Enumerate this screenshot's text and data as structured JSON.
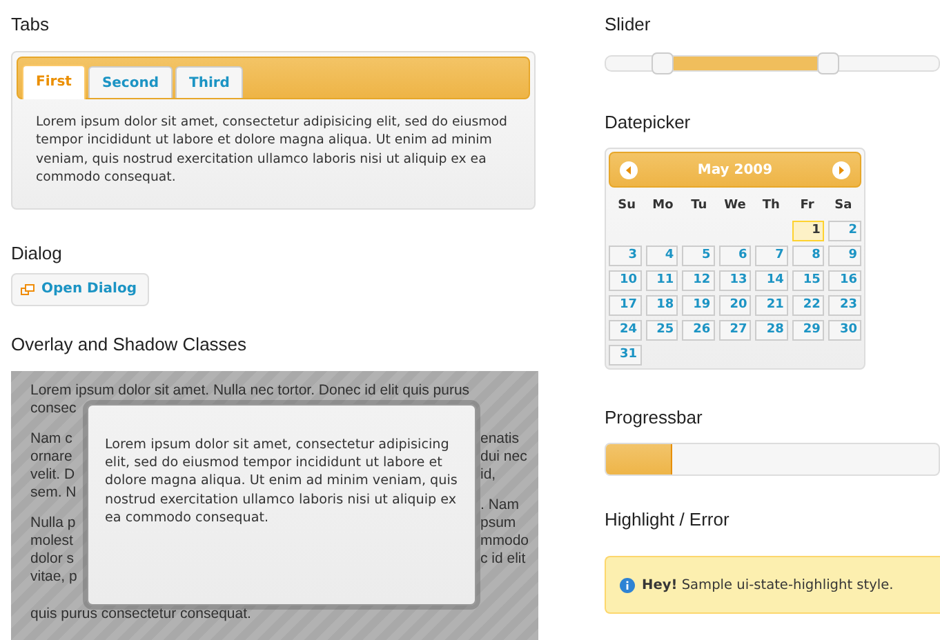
{
  "tabs_section": {
    "heading": "Tabs",
    "tabs": [
      {
        "label": "First",
        "selected": true
      },
      {
        "label": "Second",
        "selected": false
      },
      {
        "label": "Third",
        "selected": false
      }
    ],
    "panel_text": "Lorem ipsum dolor sit amet, consectetur adipisicing elit, sed do eiusmod tempor incididunt ut labore et dolore magna aliqua. Ut enim ad minim veniam, quis nostrud exercitation ullamco laboris nisi ut aliquip ex ea commodo consequat."
  },
  "dialog_section": {
    "heading": "Dialog",
    "button": "Open Dialog"
  },
  "overlay_section": {
    "heading": "Overlay and Shadow Classes",
    "top_line": "Lorem ipsum dolor sit amet. Nulla nec tortor. Donec id elit quis purus",
    "left_fragments": [
      [
        "consec"
      ],
      [
        "Nam c",
        "ornare",
        "velit. D",
        "sem. N"
      ],
      [
        "Nulla p",
        "molest",
        "dolor s",
        "vitae, p"
      ]
    ],
    "right_fragments": [
      [
        "enatis",
        "dui nec",
        "id,"
      ],
      [
        ". Nam",
        "psum",
        "mmodo",
        "c id elit"
      ]
    ],
    "bottom_line": "quis purus consectetur consequat.",
    "dialog_text": "Lorem ipsum dolor sit amet, consectetur adipisicing elit, sed do eiusmod tempor incididunt ut labore et dolore magna aliqua. Ut enim ad minim veniam, quis nostrud exercitation ullamco laboris nisi ut aliquip ex ea commodo consequat."
  },
  "slider_section": {
    "heading": "Slider",
    "handles": [
      {
        "level": 0.17
      },
      {
        "level": 0.67
      }
    ]
  },
  "datepicker_section": {
    "heading": "Datepicker",
    "month": "May 2009",
    "weekdays": [
      "Su",
      "Mo",
      "Tu",
      "We",
      "Th",
      "Fr",
      "Sa"
    ],
    "weeks": [
      [
        {
          "day": "1",
          "highlighted": true
        },
        {
          "day": "2",
          "highlighted": false
        }
      ],
      [
        {
          "day": "3",
          "highlighted": false
        },
        {
          "day": "4",
          "highlighted": false
        },
        {
          "day": "5",
          "highlighted": false
        },
        {
          "day": "6",
          "highlighted": false
        },
        {
          "day": "7",
          "highlighted": false
        },
        {
          "day": "8",
          "highlighted": false
        },
        {
          "day": "9",
          "highlighted": false
        }
      ],
      [
        {
          "day": "10",
          "highlighted": false
        },
        {
          "day": "11",
          "highlighted": false
        },
        {
          "day": "12",
          "highlighted": false
        },
        {
          "day": "13",
          "highlighted": false
        },
        {
          "day": "14",
          "highlighted": false
        },
        {
          "day": "15",
          "highlighted": false
        },
        {
          "day": "16",
          "highlighted": false
        }
      ],
      [
        {
          "day": "17",
          "highlighted": false
        },
        {
          "day": "18",
          "highlighted": false
        },
        {
          "day": "19",
          "highlighted": false
        },
        {
          "day": "20",
          "highlighted": false
        },
        {
          "day": "21",
          "highlighted": false
        },
        {
          "day": "22",
          "highlighted": false
        },
        {
          "day": "23",
          "highlighted": false
        }
      ],
      [
        {
          "day": "24",
          "highlighted": false
        },
        {
          "day": "25",
          "highlighted": false
        },
        {
          "day": "26",
          "highlighted": false
        },
        {
          "day": "27",
          "highlighted": false
        },
        {
          "day": "28",
          "highlighted": false
        },
        {
          "day": "29",
          "highlighted": false
        },
        {
          "day": "30",
          "highlighted": false
        }
      ],
      [
        {
          "day": "31",
          "highlighted": false
        }
      ]
    ]
  },
  "progressbar_section": {
    "heading": "Progressbar",
    "level": 0.2
  },
  "highlight_section": {
    "heading": "Highlight / Error",
    "message": "**Hey!** Sample ui-state-highlight style."
  }
}
